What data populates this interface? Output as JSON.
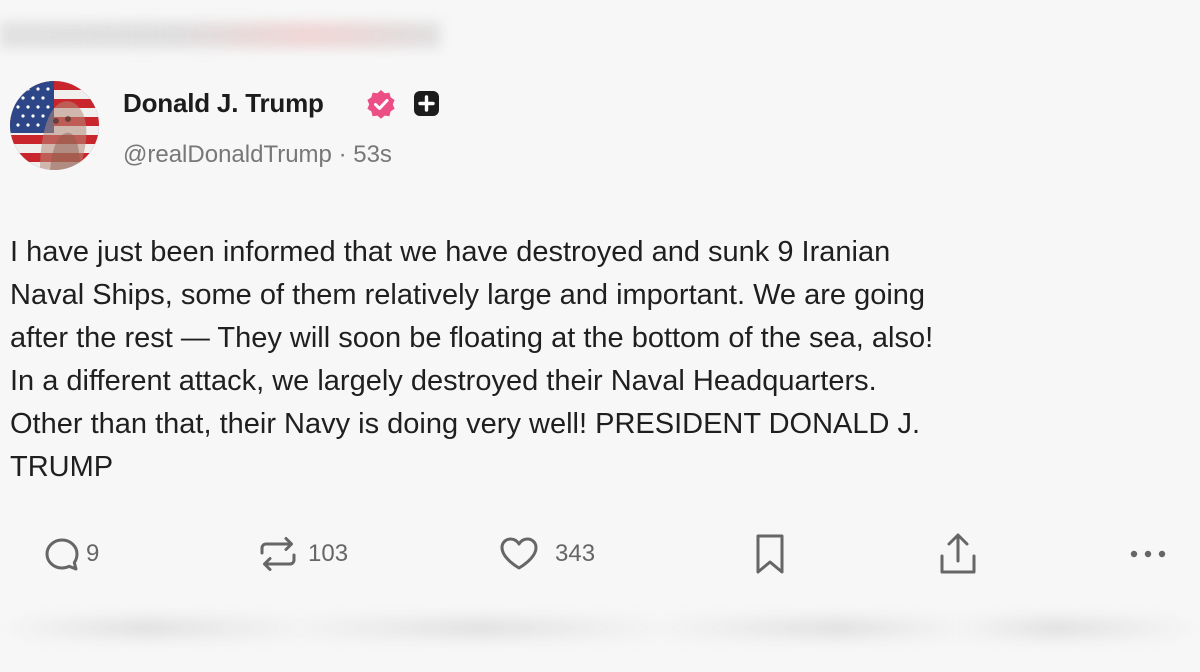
{
  "post": {
    "author": {
      "display_name": "Donald J. Trump",
      "handle": "@realDonaldTrump",
      "separator": "·",
      "time_ago": "53s",
      "verified_icon": "verified-badge-icon",
      "plus_icon": "plus-badge-icon"
    },
    "body_text": "I have just been informed that we have destroyed and sunk 9 Iranian\nNaval Ships, some of them relatively large and important. We are going\nafter the rest — They will soon be floating at the bottom of the sea, also!\nIn a different attack, we largely destroyed their Naval Headquarters.\nOther than that, their Navy is doing very well! PRESIDENT DONALD J.\nTRUMP",
    "actions": {
      "reply_count": "9",
      "repost_count": "103",
      "like_count": "343"
    }
  },
  "colors": {
    "verified_badge": "#ec4f86",
    "text_primary": "#1f1f1f",
    "text_secondary": "#777777",
    "icon_gray": "#666666",
    "background": "#f7f7f7"
  }
}
